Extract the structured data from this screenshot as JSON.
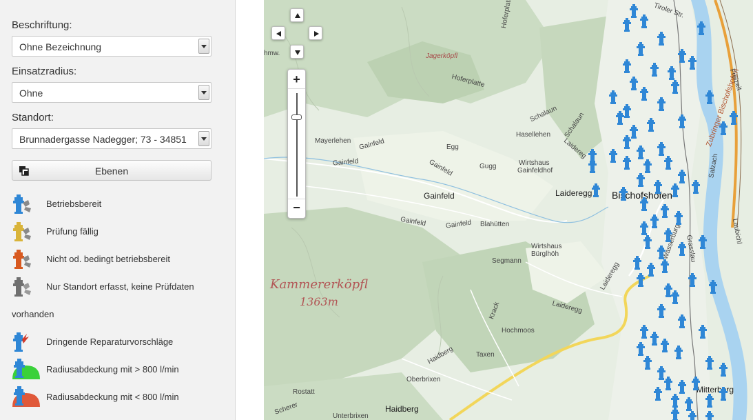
{
  "sidebar": {
    "beschriftung": {
      "label": "Beschriftung:",
      "value": "Ohne Bezeichnung"
    },
    "einsatzradius": {
      "label": "Einsatzradius:",
      "value": "Ohne"
    },
    "standort": {
      "label": "Standort:",
      "value": "Brunnadergasse Nadegger; 73 - 34851"
    },
    "layers_button": {
      "label": "Ebenen",
      "icon": "layers-icon"
    },
    "legend": [
      {
        "label": "Betriebsbereit",
        "icon": "hydrant-blue-icon",
        "color": "#2f87d6"
      },
      {
        "label": "Prüfung fällig",
        "icon": "hydrant-yellow-icon",
        "color": "#d9b43a"
      },
      {
        "label": "Nicht od. bedingt betriebsbereit",
        "icon": "hydrant-orange-icon",
        "color": "#d8591f"
      },
      {
        "label": "Nur Standort erfasst, keine Prüfdaten",
        "icon": "hydrant-gray-icon",
        "color": "#707070"
      }
    ],
    "legend_note": "vorhanden",
    "legend2": [
      {
        "label": "Dringende Reparaturvorschläge",
        "icon": "hydrant-repair-icon",
        "color": "#2f87d6"
      },
      {
        "label": "Radiusabdeckung mit > 800 l/min",
        "icon": "radius-green-icon",
        "color": "#3ad13a"
      },
      {
        "label": "Radiusabdeckung mit < 800 l/min",
        "icon": "radius-red-icon",
        "color": "#e0593a"
      }
    ]
  },
  "map": {
    "places": {
      "jagerkopfl": "Jagerköpfl",
      "hoferplattl": "Hoferplattl",
      "hoferplatte": "Hoferplatte",
      "schalaun1": "Schalaun",
      "schalaun2": "Schalaun",
      "hasellehen": "Hasellehen",
      "mayerlehen": "Mayerlehen",
      "gainfeld1": "Gainfeld",
      "gainfeld2": "Gainfeld",
      "gainfeld3": "Gainfeld",
      "gainfeld4": "Gainfeld",
      "gainfeld5": "Gainfeld",
      "gainfeld_town": "Gainfeld",
      "egg": "Egg",
      "gugg": "Gugg",
      "wirtshaus1a": "Wirtshaus",
      "wirtshaus1b": "Gainfeldhof",
      "laideregg": "Laideregg",
      "laidereg_road": "Laidereg",
      "bischofshofen": "Bischofshofen",
      "blahutten": "Blahütten",
      "wirtshaus2a": "Wirtshaus",
      "wirtshaus2b": "Bürglhöh",
      "segmann": "Segmann",
      "kammererkopfl": "Kammererköpfl",
      "kammerer_elev": "1363m",
      "laideregg2": "Laideregg",
      "laideregg3": "Laideregg",
      "krack": "Krack",
      "hochmoos": "Hochmoos",
      "taxen": "Taxen",
      "haidberg1": "Haidberg",
      "haidberg2": "Haidberg",
      "oberbrixen": "Oberbrixen",
      "rostatt": "Rostatt",
      "scherer": "Scherer",
      "unterbrixen": "Unterbrixen",
      "mitterberg": "Mitterberg",
      "zubringer": "Zubringer Bischofshofen",
      "salzach": "Salzach",
      "laubichl": "Laubichl",
      "grasslau": "Grasslau",
      "wasserburg": "Wasserburg",
      "tiroler": "Tiroler Str.",
      "freizeit": "Freizeit",
      "bahnwm": "hmw."
    },
    "controls": {
      "zoom_in": "+",
      "zoom_out": "−"
    }
  }
}
